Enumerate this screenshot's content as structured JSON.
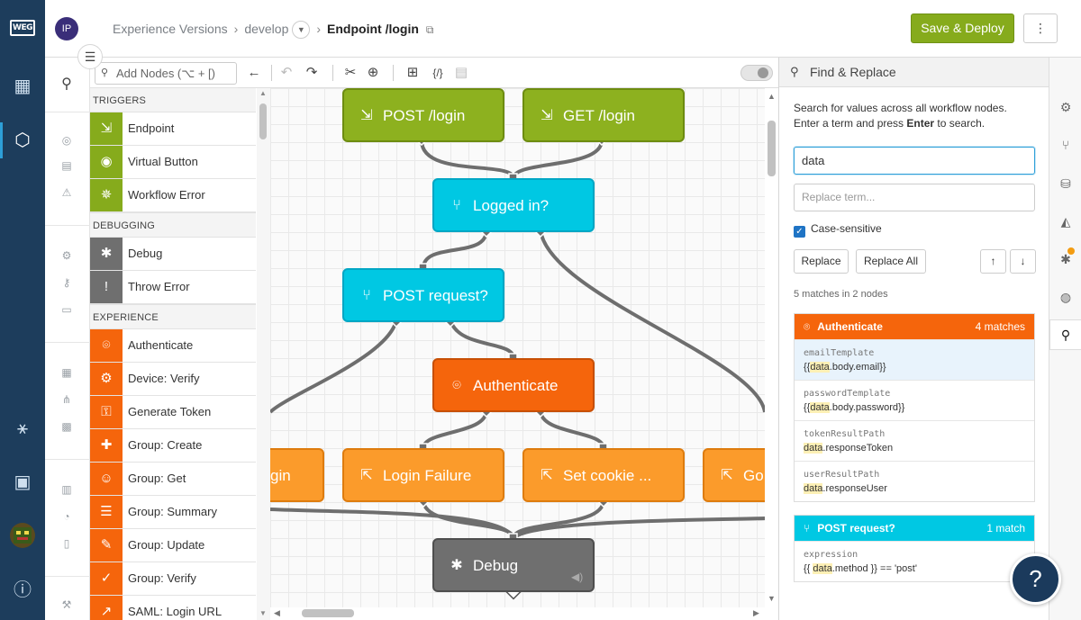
{
  "header": {
    "avatar_initials": "IP",
    "breadcrumb": [
      "Experience Versions",
      "develop",
      "Endpoint /login"
    ],
    "separator": "›",
    "save_label": "Save & Deploy",
    "more_label": "⋮",
    "accent": "#86ab1c"
  },
  "nav": {
    "logo": "WEG"
  },
  "palette": {
    "search_placeholder": "Add Nodes (⌥ + [)",
    "categories": [
      {
        "label": "TRIGGERS",
        "color": "#86ab1c",
        "items": [
          {
            "label": "Endpoint",
            "icon": "⇲"
          },
          {
            "label": "Virtual Button",
            "icon": "◉"
          },
          {
            "label": "Workflow Error",
            "icon": "✵"
          }
        ]
      },
      {
        "label": "DEBUGGING",
        "color": "#6f6f6f",
        "items": [
          {
            "label": "Debug",
            "icon": "✱"
          },
          {
            "label": "Throw Error",
            "icon": "!"
          }
        ]
      },
      {
        "label": "EXPERIENCE",
        "color": "#f5650c",
        "items": [
          {
            "label": "Authenticate",
            "icon": "⌾"
          },
          {
            "label": "Device: Verify",
            "icon": "⚙"
          },
          {
            "label": "Generate Token",
            "icon": "⚿"
          },
          {
            "label": "Group: Create",
            "icon": "✚"
          },
          {
            "label": "Group: Get",
            "icon": "☺"
          },
          {
            "label": "Group: Summary",
            "icon": "☰"
          },
          {
            "label": "Group: Update",
            "icon": "✎"
          },
          {
            "label": "Group: Verify",
            "icon": "✓"
          },
          {
            "label": "SAML: Login URL",
            "icon": "↗"
          }
        ]
      }
    ]
  },
  "canvas": {
    "nodes": [
      {
        "label": "POST /login",
        "type": "trigger",
        "icon": "⇲"
      },
      {
        "label": "GET /login",
        "type": "trigger",
        "icon": "⇲"
      },
      {
        "label": "Logged in?",
        "type": "conditional",
        "icon": "⑂"
      },
      {
        "label": "POST request?",
        "type": "conditional",
        "icon": "⑂"
      },
      {
        "label": "Authenticate",
        "type": "experience",
        "icon": "⌾"
      },
      {
        "label": "gin",
        "type": "output",
        "icon": ""
      },
      {
        "label": "Login Failure",
        "type": "output",
        "icon": "⇱"
      },
      {
        "label": "Set cookie ...",
        "type": "output",
        "icon": "⇱"
      },
      {
        "label": "Go t",
        "type": "output",
        "icon": "⇱"
      },
      {
        "label": "Debug",
        "type": "debug",
        "icon": "✱"
      }
    ]
  },
  "find_replace": {
    "title": "Find & Replace",
    "desc_1": "Search for values across all workflow nodes.",
    "desc_2a": "Enter a term and press ",
    "desc_key": "Enter",
    "desc_2b": " to search.",
    "search_value": "data",
    "replace_placeholder": "Replace term...",
    "case_sensitive_label": "Case-sensitive",
    "case_sensitive": true,
    "replace_label": "Replace",
    "replace_all_label": "Replace All",
    "summary": "5 matches in 2 nodes",
    "groups": [
      {
        "node": "Authenticate",
        "count": "4 matches",
        "color": "#f5650c",
        "icon": "⌾",
        "results": [
          {
            "key": "emailTemplate",
            "pre": "{{",
            "match": "data",
            "post": ".body.email}}"
          },
          {
            "key": "passwordTemplate",
            "pre": "{{",
            "match": "data",
            "post": ".body.password}}"
          },
          {
            "key": "tokenResultPath",
            "pre": "",
            "match": "data",
            "post": ".responseToken"
          },
          {
            "key": "userResultPath",
            "pre": "",
            "match": "data",
            "post": ".responseUser"
          }
        ]
      },
      {
        "node": "POST request?",
        "count": "1 match",
        "color": "#00c8e3",
        "icon": "⑂",
        "results": [
          {
            "key": "expression",
            "pre": "{{ ",
            "match": "data",
            "post": ".method }} == 'post'"
          }
        ]
      }
    ]
  },
  "help_label": "?"
}
